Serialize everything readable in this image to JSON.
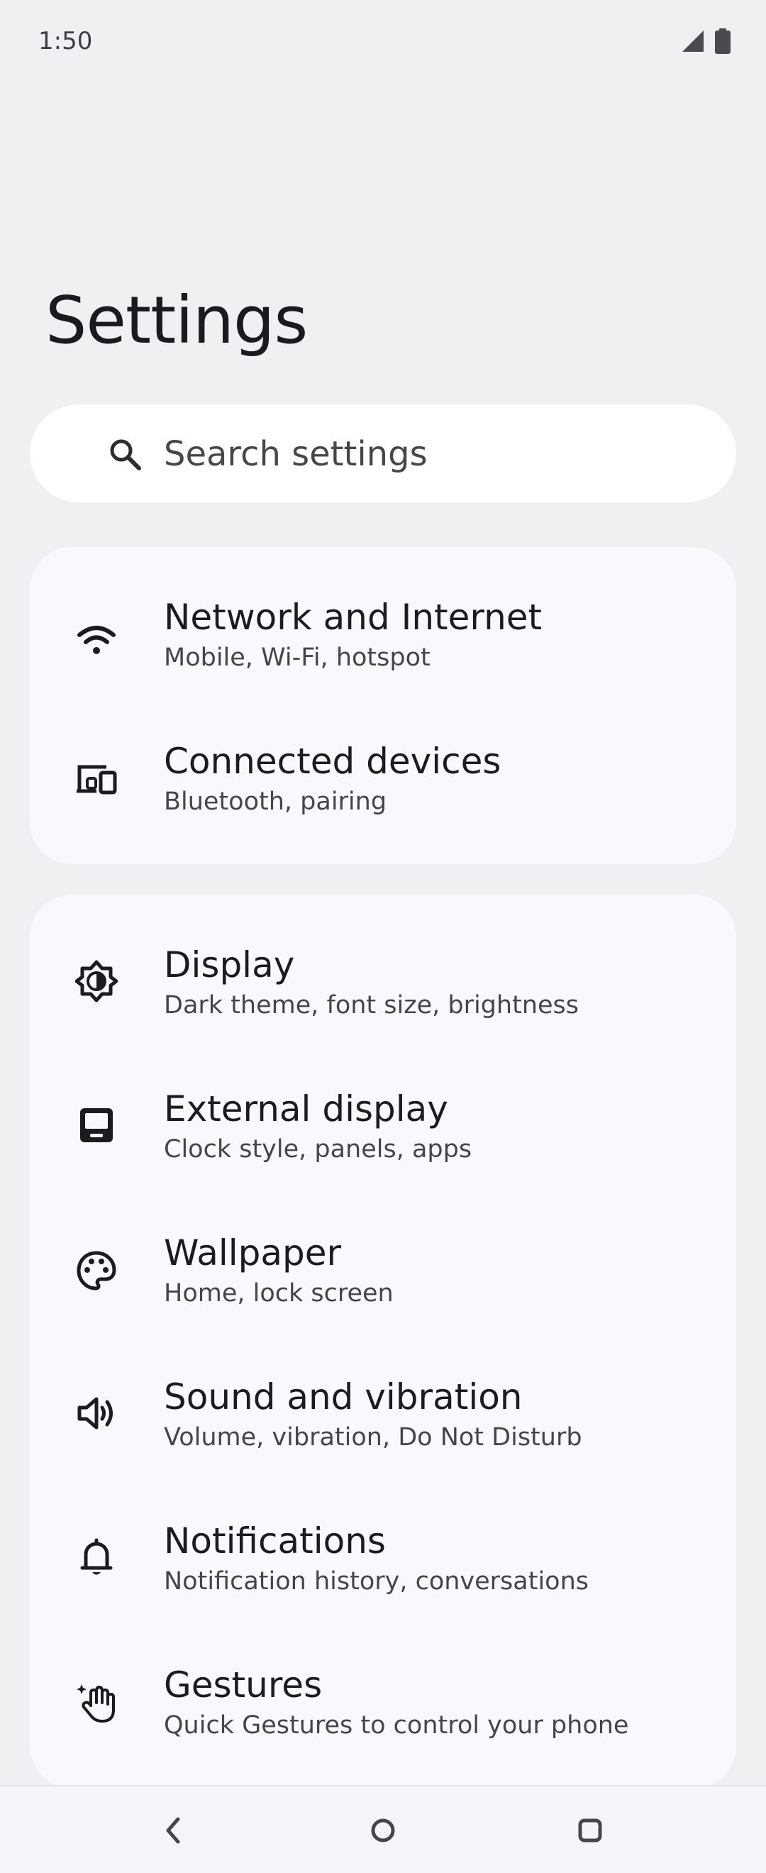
{
  "status_bar": {
    "time": "1:50",
    "icons": [
      "cell-signal-icon",
      "battery-icon"
    ]
  },
  "page": {
    "title": "Settings"
  },
  "search": {
    "placeholder": "Search settings"
  },
  "groups": [
    {
      "items": [
        {
          "icon": "wifi-icon",
          "title": "Network and Internet",
          "subtitle": "Mobile, Wi‑Fi, hotspot"
        },
        {
          "icon": "connected-devices-icon",
          "title": "Connected devices",
          "subtitle": "Bluetooth, pairing"
        }
      ]
    },
    {
      "items": [
        {
          "icon": "display-brightness-icon",
          "title": "Display",
          "subtitle": "Dark theme, font size, brightness"
        },
        {
          "icon": "external-display-icon",
          "title": "External display",
          "subtitle": "Clock style, panels, apps"
        },
        {
          "icon": "palette-icon",
          "title": "Wallpaper",
          "subtitle": "Home, lock screen"
        },
        {
          "icon": "volume-icon",
          "title": "Sound and vibration",
          "subtitle": "Volume, vibration, Do Not Disturb"
        },
        {
          "icon": "bell-icon",
          "title": "Notifications",
          "subtitle": "Notification history, conversations"
        },
        {
          "icon": "gesture-hand-icon",
          "title": "Gestures",
          "subtitle": "Quick Gestures to control your phone"
        }
      ]
    }
  ],
  "navigation": {
    "buttons": [
      "back-icon",
      "home-icon",
      "recents-icon"
    ]
  },
  "colors": {
    "background": "#eff0f2",
    "card": "#f8f9ff",
    "search": "#ffffff",
    "text_primary": "#1b1c20",
    "text_secondary": "#45464c"
  }
}
